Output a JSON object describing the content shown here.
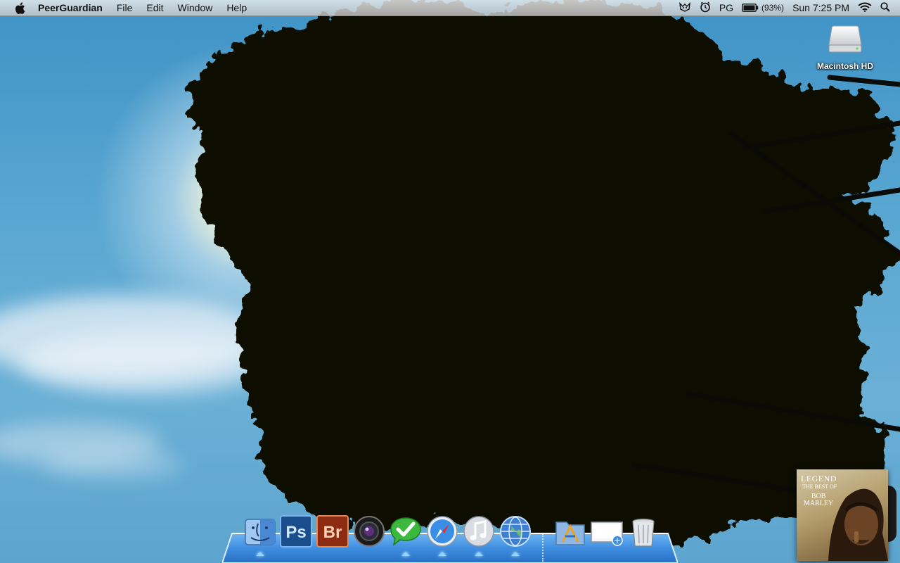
{
  "menubar": {
    "app_name": "PeerGuardian",
    "menus": [
      "File",
      "Edit",
      "Window",
      "Help"
    ],
    "status": {
      "peerguardian_label": "PG",
      "battery_percent": "(93%)",
      "clock": "Sun 7:25 PM"
    }
  },
  "desktop": {
    "disk_label": "Macintosh HD"
  },
  "album": {
    "title": "LEGEND",
    "subtitle": "THE BEST OF",
    "artist_line1": "BOB",
    "artist_line2": "MARLEY"
  },
  "dock": {
    "apps": [
      {
        "icon": "finder-icon",
        "running": true
      },
      {
        "icon": "photoshop-icon",
        "label": "Ps",
        "running": false
      },
      {
        "icon": "bridge-icon",
        "label": "Br",
        "running": false
      },
      {
        "icon": "camera-app-icon",
        "running": false
      },
      {
        "icon": "chat-check-icon",
        "running": true
      },
      {
        "icon": "safari-icon",
        "running": true
      },
      {
        "icon": "itunes-icon",
        "running": true
      },
      {
        "icon": "globe-icon",
        "running": true
      }
    ],
    "stacks": [
      {
        "icon": "applications-folder-icon"
      },
      {
        "icon": "downloads-stack-icon"
      },
      {
        "icon": "trash-icon"
      }
    ]
  },
  "colors": {
    "sky": "#4f9bc9",
    "dock_blue": "#3f8ee0",
    "indicator": "#8fd4ff"
  }
}
